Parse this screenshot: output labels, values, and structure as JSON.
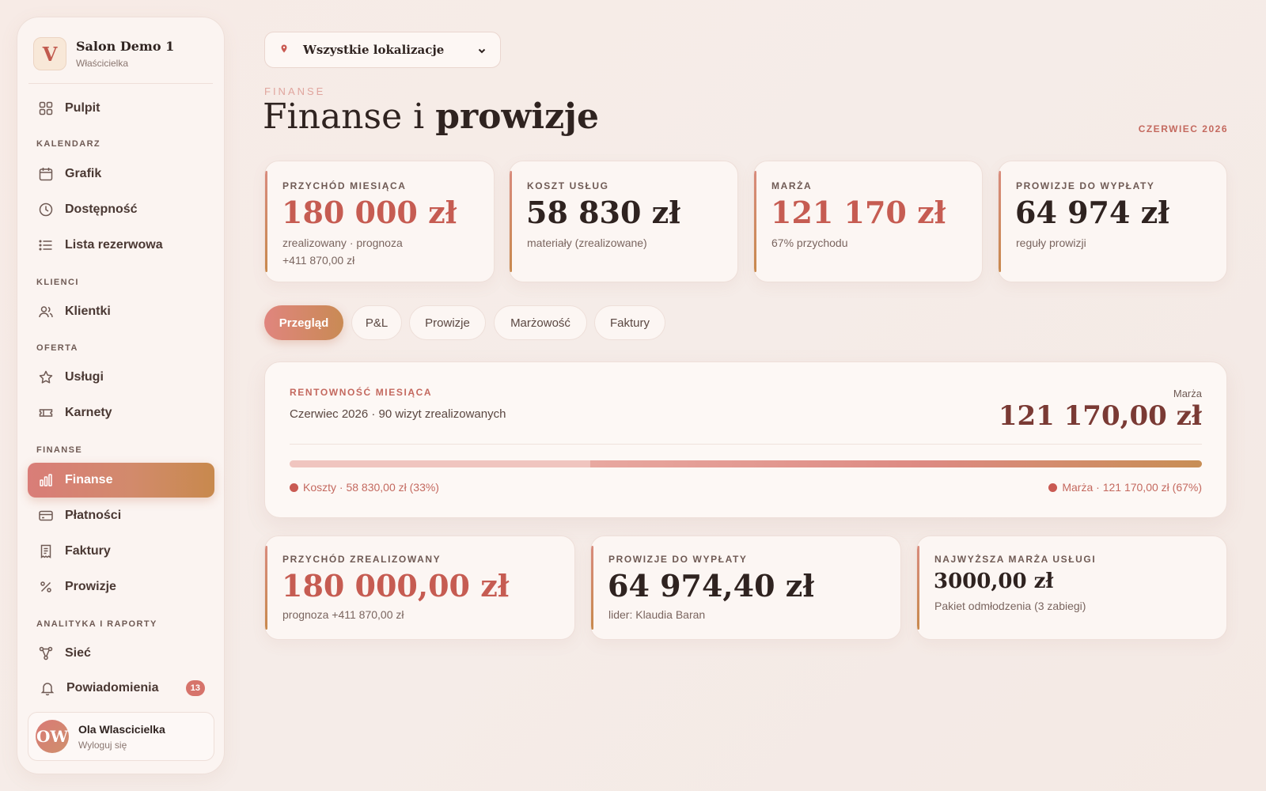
{
  "sidebar": {
    "brand": {
      "logo_letter": "V",
      "name": "Salon Demo 1",
      "role": "Właścicielka"
    },
    "items": {
      "pulpit": "Pulpit",
      "grafik": "Grafik",
      "dostepnosc": "Dostępność",
      "lista": "Lista rezerwowa",
      "klientki": "Klientki",
      "uslugi": "Usługi",
      "karnety": "Karnety",
      "finanse": "Finanse",
      "platnosci": "Płatności",
      "faktury": "Faktury",
      "prowizje": "Prowizje",
      "siec": "Sieć",
      "powiadomienia": "Powiadomienia"
    },
    "sections": {
      "kalendarz": "KALENDARZ",
      "klienci": "KLIENCI",
      "oferta": "OFERTA",
      "finanse": "FINANSE",
      "analityka": "ANALITYKA I RAPORTY"
    },
    "notifications_count": "13",
    "user": {
      "initials": "OW",
      "name": "Ola Wlascicielka",
      "action": "Wyloguj się"
    }
  },
  "header": {
    "location_select": "Wszystkie lokalizacje",
    "eyebrow": "FINANSE",
    "title_light": "Finanse i ",
    "title_bold": "prowizje",
    "period": "CZERWIEC 2026"
  },
  "kpis": [
    {
      "label": "PRZYCHÓD MIESIĄCA",
      "value": "180 000 zł",
      "sub1": "zrealizowany · prognoza",
      "sub2": "+411 870,00 zł"
    },
    {
      "label": "KOSZT USŁUG",
      "value": "58 830 zł",
      "sub1": "materiały (zrealizowane)",
      "sub2": ""
    },
    {
      "label": "MARŻA",
      "value": "121 170 zł",
      "sub1": "67% przychodu",
      "sub2": ""
    },
    {
      "label": "PROWIZJE DO WYPŁATY",
      "value": "64 974 zł",
      "sub1": "reguły prowizji",
      "sub2": ""
    }
  ],
  "tabs": [
    "Przegląd",
    "P&L",
    "Prowizje",
    "Marżowość",
    "Faktury"
  ],
  "profitability": {
    "label": "RENTOWNOŚĆ MIESIĄCA",
    "subtitle": "Czerwiec 2026 · 90 wizyt zrealizowanych",
    "right_label": "Marża",
    "right_value": "121 170,00 zł",
    "cost_share": 0.33,
    "margin_share": 0.67,
    "legend_cost": "Koszty · 58 830,00 zł (33%)",
    "legend_margin": "Marża · 121 170,00 zł (67%)"
  },
  "stats": [
    {
      "label": "PRZYCHÓD ZREALIZOWANY",
      "value": "180 000,00 zł",
      "sub": "prognoza +411 870,00 zł"
    },
    {
      "label": "PROWIZJE DO WYPŁATY",
      "value": "64 974,40 zł",
      "sub": "lider: Klaudia Baran"
    },
    {
      "label": "NAJWYŻSZA MARŻA USŁUGI",
      "value": "3000,00 zł",
      "sub": "Pakiet odmłodzenia (3 zabiegi)"
    }
  ],
  "colors": {
    "accent": "#c65c52",
    "gradient_start": "#d97d78",
    "gradient_end": "#c8894d",
    "background": "#f6ece8"
  }
}
